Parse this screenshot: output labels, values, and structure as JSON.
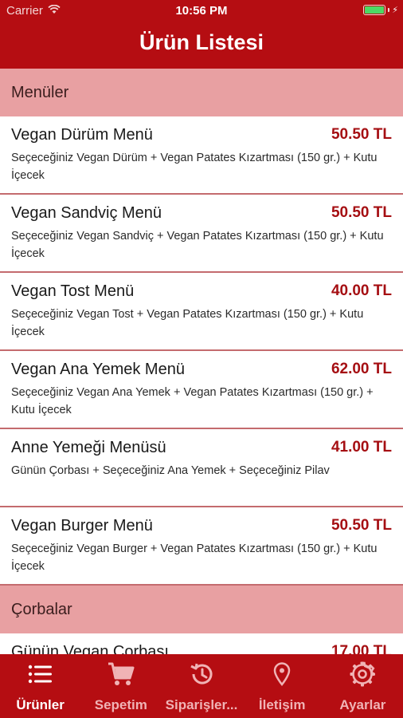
{
  "status_bar": {
    "carrier": "Carrier",
    "time": "10:56 PM"
  },
  "header": {
    "title": "Ürün Listesi"
  },
  "sections": [
    {
      "title": "Menüler",
      "items": [
        {
          "name": "Vegan Dürüm Menü",
          "price": "50.50 TL",
          "description": "Seçeceğiniz Vegan Dürüm + Vegan Patates Kızartması (150 gr.) + Kutu İçecek"
        },
        {
          "name": "Vegan Sandviç Menü",
          "price": "50.50 TL",
          "description": "Seçeceğiniz Vegan Sandviç + Vegan Patates Kızartması (150 gr.) + Kutu İçecek"
        },
        {
          "name": "Vegan Tost Menü",
          "price": "40.00 TL",
          "description": "Seçeceğiniz Vegan Tost + Vegan Patates Kızartması (150 gr.) + Kutu İçecek"
        },
        {
          "name": "Vegan Ana Yemek Menü",
          "price": "62.00 TL",
          "description": "Seçeceğiniz Vegan Ana Yemek + Vegan Patates Kızartması (150 gr.) + Kutu İçecek"
        },
        {
          "name": "Anne Yemeği Menüsü",
          "price": "41.00 TL",
          "description": "Günün Çorbası + Seçeceğiniz Ana Yemek + Seçeceğiniz Pilav"
        },
        {
          "name": "Vegan Burger Menü",
          "price": "50.50 TL",
          "description": "Seçeceğiniz Vegan Burger + Vegan Patates Kızartması (150 gr.) + Kutu İçecek"
        }
      ]
    },
    {
      "title": "Çorbalar",
      "items": [
        {
          "name": "Günün Vegan Çorbası",
          "price": "17.00 TL",
          "description": ""
        }
      ]
    }
  ],
  "tabbar": {
    "items": [
      {
        "label": "Ürünler",
        "icon": "list-icon",
        "active": true
      },
      {
        "label": "Sepetim",
        "icon": "cart-icon",
        "active": false
      },
      {
        "label": "Siparişler...",
        "icon": "history-icon",
        "active": false
      },
      {
        "label": "İletişim",
        "icon": "location-pin-icon",
        "active": false
      },
      {
        "label": "Ayarlar",
        "icon": "gear-icon",
        "active": false
      }
    ]
  },
  "colors": {
    "primary": "#b50d12",
    "section_bg": "#e8a0a2",
    "price": "#a50e12",
    "tab_inactive": "#f0b3b5"
  }
}
